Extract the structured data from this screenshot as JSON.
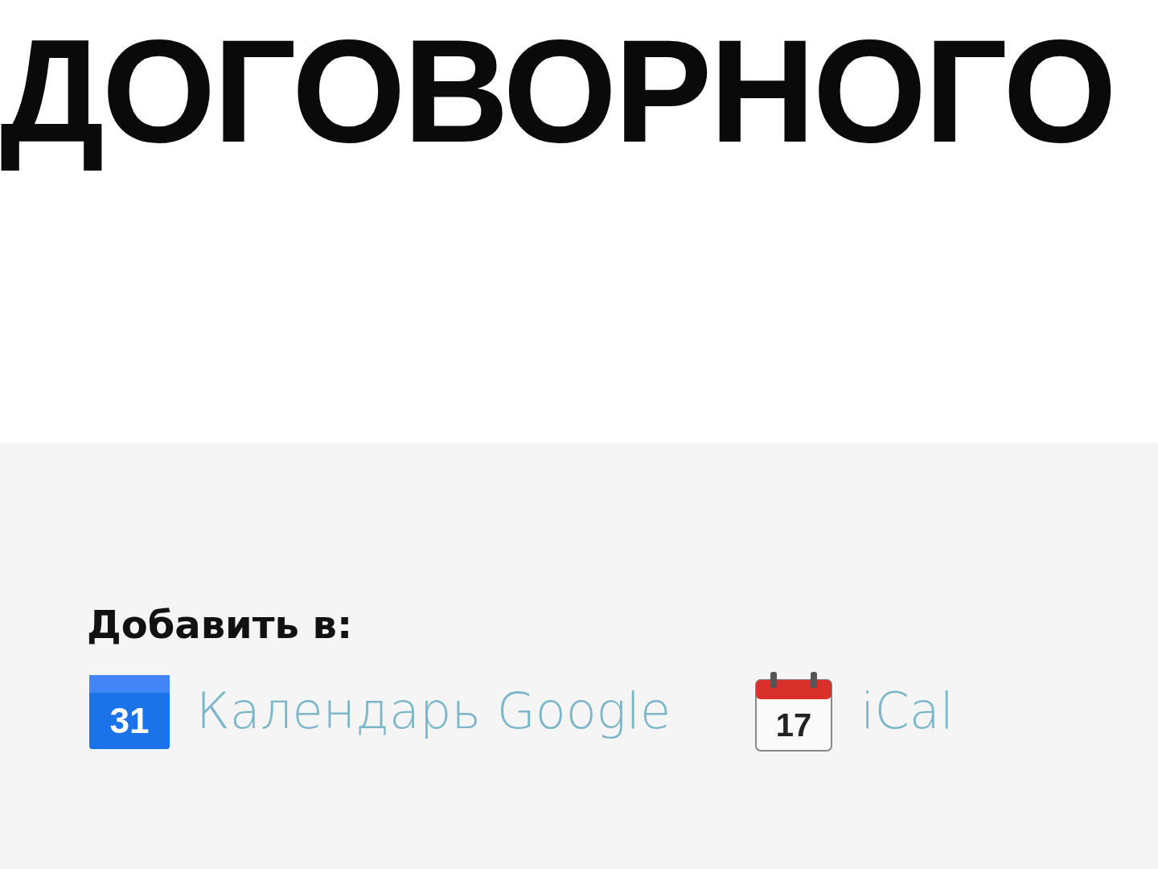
{
  "heading": "ДОГОВОРНОГО",
  "add_to": {
    "label": "Добавить в:",
    "links": [
      {
        "kind": "google",
        "text": "Календарь Google",
        "icon_text": "31"
      },
      {
        "kind": "ical",
        "text": "iCal",
        "icon_text": "17"
      }
    ]
  }
}
